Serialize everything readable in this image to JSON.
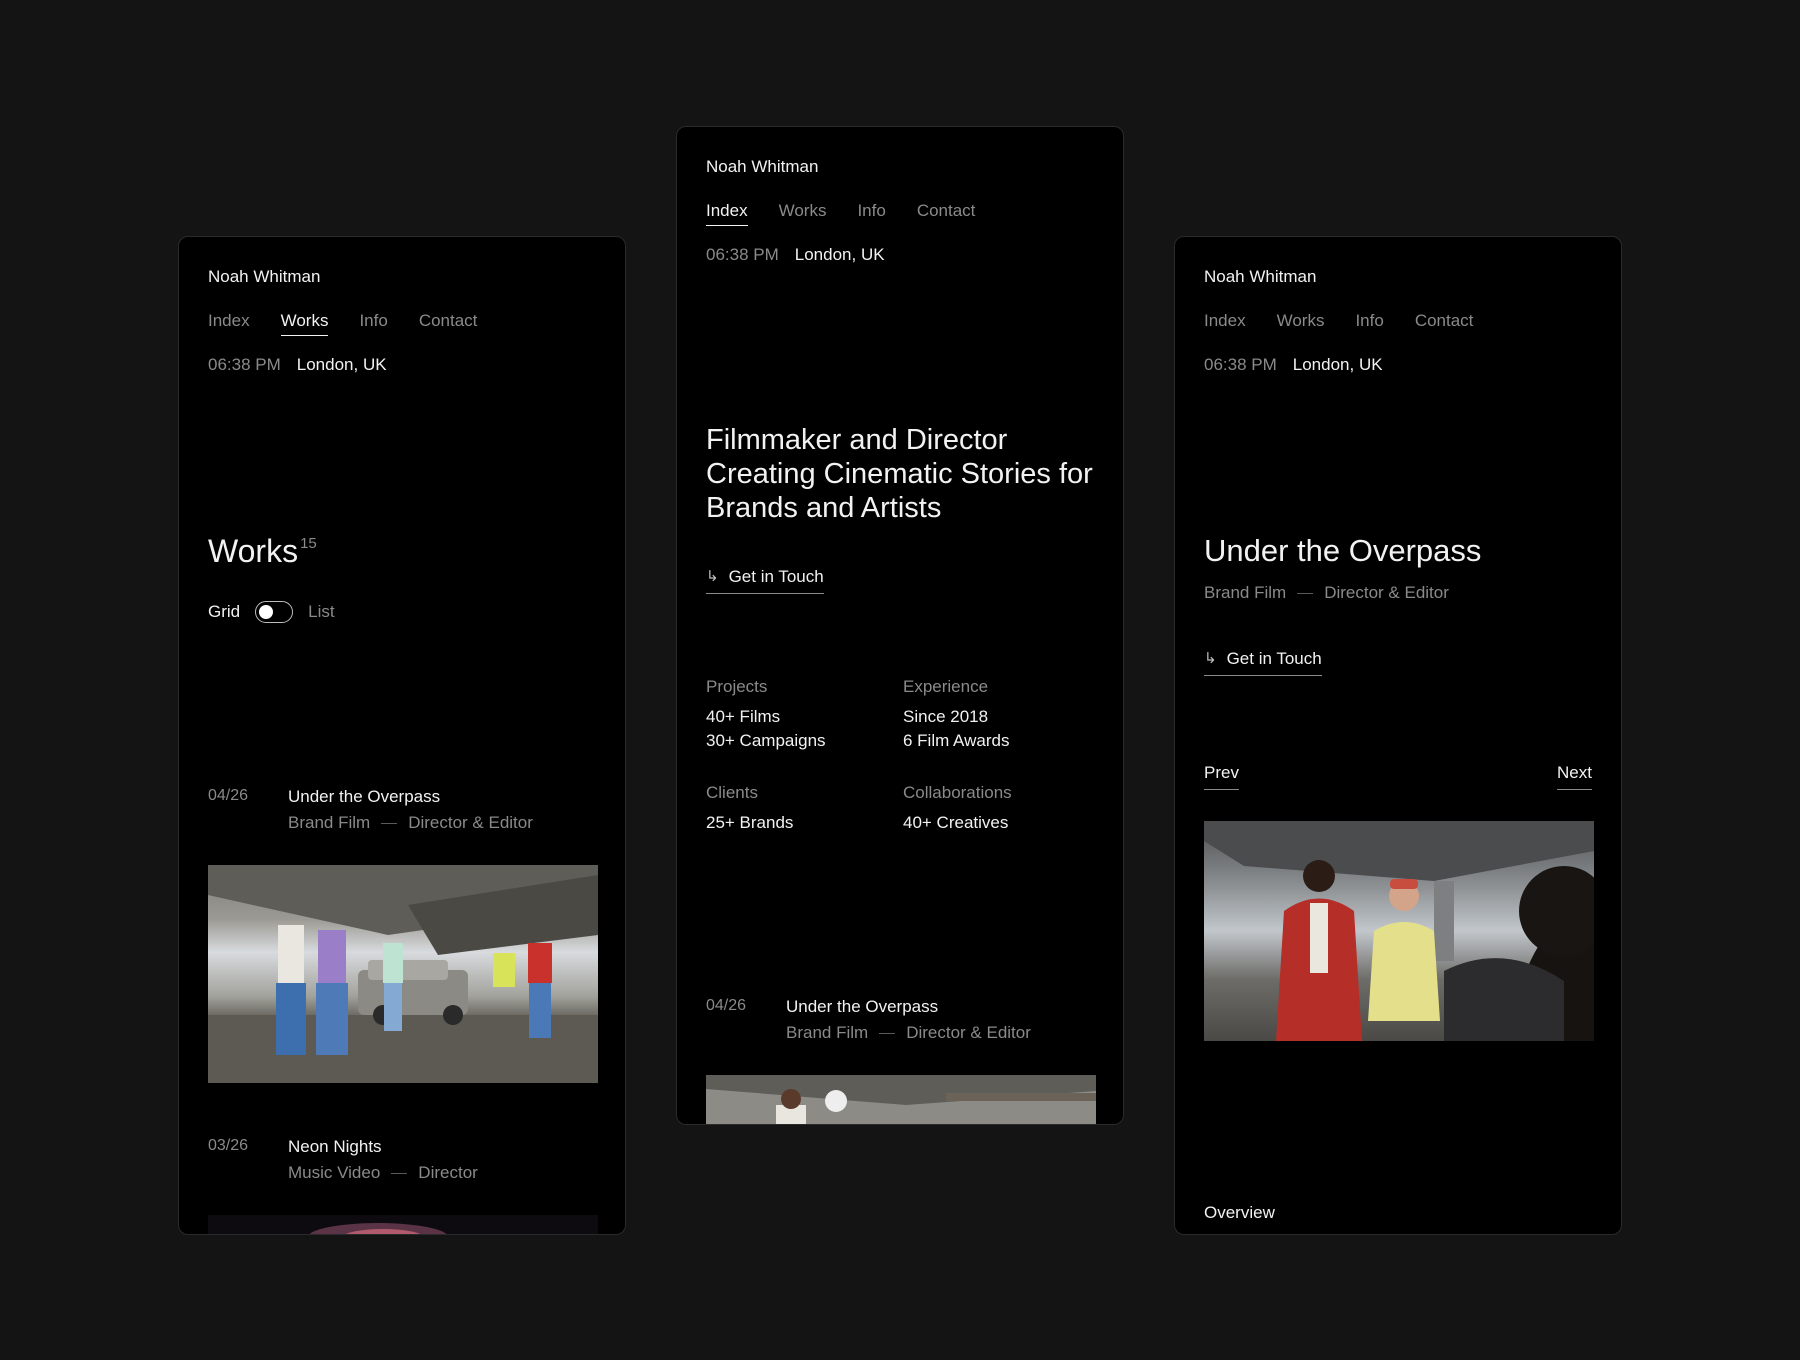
{
  "site": {
    "brand": "Noah Whitman",
    "nav": [
      "Index",
      "Works",
      "Info",
      "Contact"
    ],
    "time": "06:38 PM",
    "location": "London, UK"
  },
  "works_screen": {
    "active_nav": "Works",
    "title": "Works",
    "count": "15",
    "toggle": {
      "left_label": "Grid",
      "right_label": "List",
      "selected": "Grid"
    },
    "items": [
      {
        "num": "04/26",
        "title": "Under the Overpass",
        "category": "Brand Film",
        "role": "Director & Editor"
      },
      {
        "num": "03/26",
        "title": "Neon Nights",
        "category": "Music Video",
        "role": "Director"
      }
    ]
  },
  "index_screen": {
    "active_nav": "Index",
    "headline": "Filmmaker and Director Creating Cinematic Stories for Brands and Artists",
    "cta": "Get in Touch",
    "stats": [
      {
        "label": "Projects",
        "lines": [
          "40+ Films",
          "30+ Campaigns"
        ]
      },
      {
        "label": "Experience",
        "lines": [
          "Since 2018",
          "6 Film Awards"
        ]
      },
      {
        "label": "Clients",
        "lines": [
          "25+ Brands"
        ]
      },
      {
        "label": "Collaborations",
        "lines": [
          "40+ Creatives"
        ]
      }
    ],
    "item": {
      "num": "04/26",
      "title": "Under the Overpass",
      "category": "Brand Film",
      "role": "Director & Editor"
    }
  },
  "project_screen": {
    "title": "Under the Overpass",
    "category": "Brand Film",
    "role": "Director & Editor",
    "cta": "Get in Touch",
    "prev": "Prev",
    "next": "Next",
    "section": "Overview"
  },
  "colors": {
    "page_bg": "#141414",
    "screen_bg": "#000000",
    "text": "#f2f2f2",
    "muted": "#8a8a8a"
  },
  "icons": {
    "cta_arrow": "arrow-down-right-icon"
  }
}
